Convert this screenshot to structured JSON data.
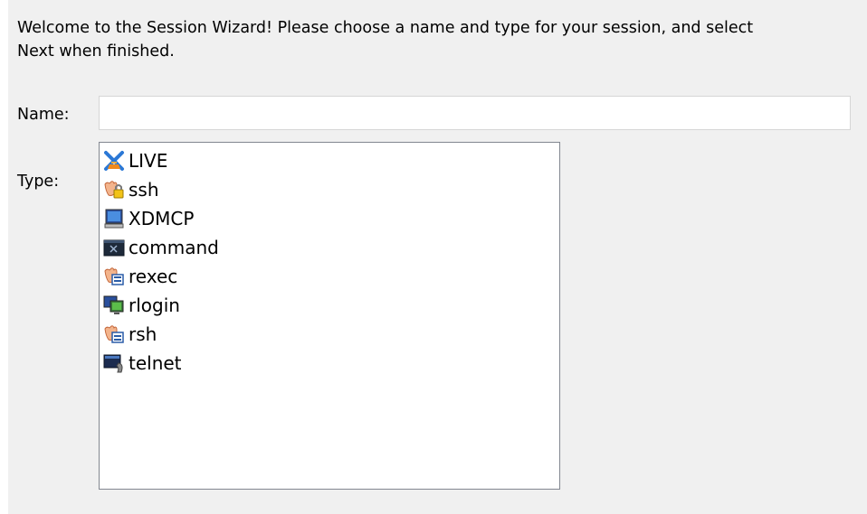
{
  "wizard": {
    "intro_line1": "Welcome to the Session Wizard!  Please choose a name and type for your session, and select",
    "intro_line2": "Next when finished."
  },
  "name_field": {
    "label": "Name:",
    "value": "",
    "placeholder": ""
  },
  "type_field": {
    "label": "Type:",
    "options": [
      {
        "label": "LIVE",
        "icon": "live-x-icon"
      },
      {
        "label": "ssh",
        "icon": "ssh-lock-icon"
      },
      {
        "label": "XDMCP",
        "icon": "monitor-icon"
      },
      {
        "label": "command",
        "icon": "terminal-icon"
      },
      {
        "label": "rexec",
        "icon": "rexec-hand-icon"
      },
      {
        "label": "rlogin",
        "icon": "rlogin-computer-icon"
      },
      {
        "label": "rsh",
        "icon": "rsh-hand-icon"
      },
      {
        "label": "telnet",
        "icon": "telnet-phone-icon"
      }
    ]
  },
  "colors": {
    "panel_background": "#f0f0f0",
    "input_background": "#ffffff",
    "list_border": "#828790"
  }
}
